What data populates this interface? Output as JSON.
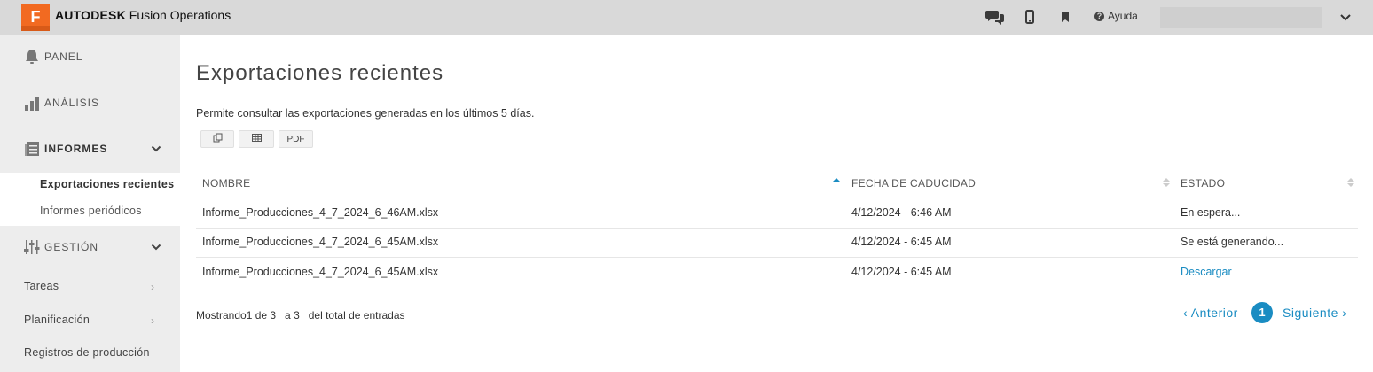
{
  "app": {
    "brand_bold": "AUTODESK",
    "brand_rest": " Fusion Operations",
    "logo_letter": "F"
  },
  "topbar": {
    "help_label": "Ayuda"
  },
  "sidebar": {
    "panel": "PANEL",
    "analisis": "ANÁLISIS",
    "informes": "INFORMES",
    "informes_sub": [
      "Exportaciones recientes",
      "Informes periódicos"
    ],
    "gestion": "GESTIÓN",
    "gestion_items": [
      "Tareas",
      "Planificación",
      "Registros de producción"
    ]
  },
  "main": {
    "title": "Exportaciones recientes",
    "description": "Permite consultar las exportaciones generadas en los últimos 5 días.",
    "buttons": {
      "copy": "",
      "csv": "",
      "pdf": "PDF"
    },
    "table": {
      "headers": [
        "NOMBRE",
        "FECHA DE CADUCIDAD",
        "ESTADO"
      ],
      "rows": [
        {
          "name": "Informe_Producciones_4_7_2024_6_46AM.xlsx",
          "date": "4/12/2024 - 6:46 AM",
          "status": "En espera..."
        },
        {
          "name": "Informe_Producciones_4_7_2024_6_45AM.xlsx",
          "date": "4/12/2024 - 6:45 AM",
          "status": "Se está generando..."
        },
        {
          "name": "Informe_Producciones_4_7_2024_6_45AM.xlsx",
          "date": "4/12/2024 - 6:45 AM",
          "status": "Descargar"
        }
      ]
    },
    "footer": {
      "info": "Mostrando1 de 3   a 3   del total de entradas"
    },
    "pagination": {
      "prev": "‹ Anterior",
      "current": "1",
      "next": "Siguiente ›"
    }
  },
  "colors": {
    "accent": "#1a8cc2",
    "logo": "#f26a21",
    "topbar": "#d9d9d9",
    "sidebar": "#ededed"
  }
}
